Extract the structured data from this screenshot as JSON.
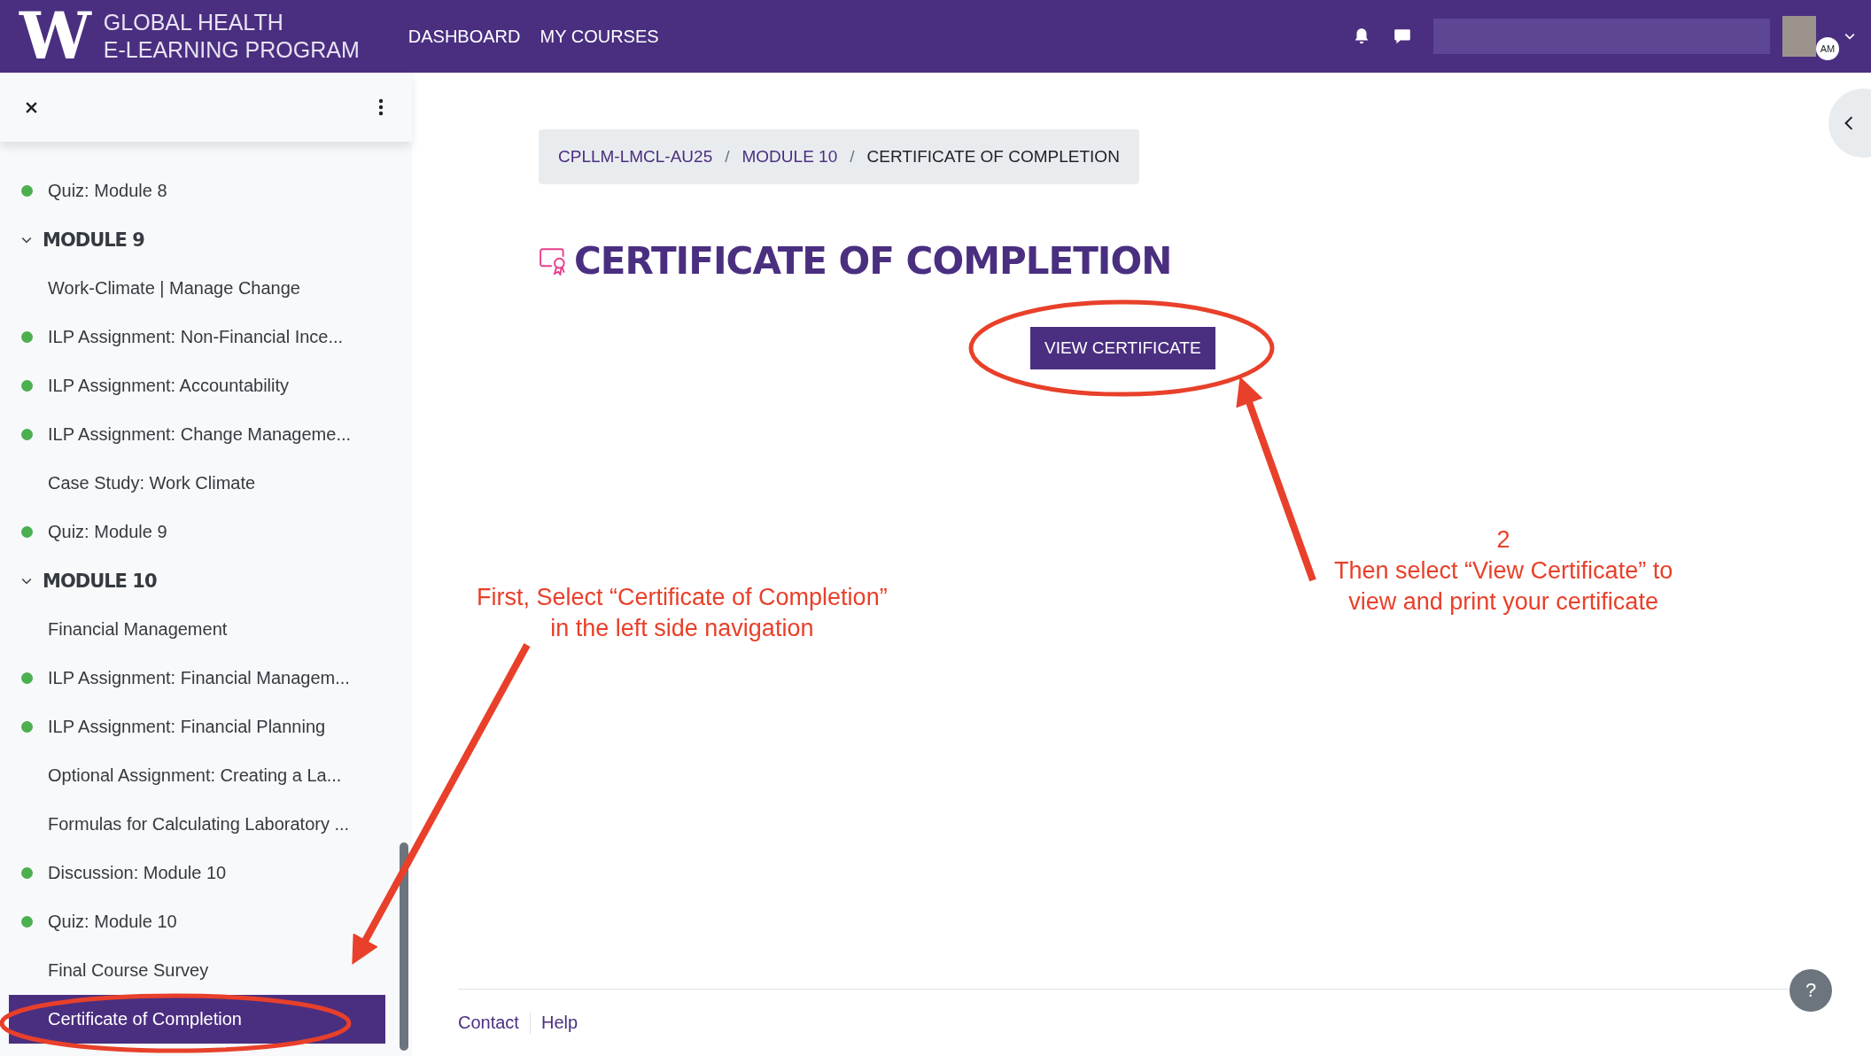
{
  "header": {
    "logo_letter": "W",
    "brand_lines": [
      "GLOBAL HEALTH",
      "E-LEARNING PROGRAM"
    ],
    "nav": [
      {
        "label": "DASHBOARD"
      },
      {
        "label": "MY COURSES"
      }
    ],
    "avatar_initials": "AM"
  },
  "sidebar": {
    "items": [
      {
        "kind": "activity",
        "label": "Quiz: Module 8",
        "completed": true,
        "selected": false
      },
      {
        "kind": "section",
        "label": "MODULE 9",
        "expanded": true,
        "children": [
          {
            "kind": "activity",
            "label": "Work-Climate | Manage Change",
            "completed": false,
            "selected": false
          },
          {
            "kind": "activity",
            "label": "ILP Assignment: Non-Financial Ince...",
            "completed": true,
            "selected": false
          },
          {
            "kind": "activity",
            "label": "ILP Assignment: Accountability",
            "completed": true,
            "selected": false
          },
          {
            "kind": "activity",
            "label": "ILP Assignment: Change Manageme...",
            "completed": true,
            "selected": false
          },
          {
            "kind": "activity",
            "label": "Case Study: Work Climate",
            "completed": false,
            "selected": false
          },
          {
            "kind": "activity",
            "label": "Quiz: Module 9",
            "completed": true,
            "selected": false
          }
        ]
      },
      {
        "kind": "section",
        "label": "MODULE 10",
        "expanded": true,
        "children": [
          {
            "kind": "activity",
            "label": "Financial Management",
            "completed": false,
            "selected": false
          },
          {
            "kind": "activity",
            "label": "ILP Assignment: Financial Managem...",
            "completed": true,
            "selected": false
          },
          {
            "kind": "activity",
            "label": "ILP Assignment: Financial Planning",
            "completed": true,
            "selected": false
          },
          {
            "kind": "activity",
            "label": "Optional Assignment: Creating a La...",
            "completed": false,
            "selected": false
          },
          {
            "kind": "activity",
            "label": "Formulas for Calculating Laboratory ...",
            "completed": false,
            "selected": false
          },
          {
            "kind": "activity",
            "label": "Discussion: Module 10",
            "completed": true,
            "selected": false
          },
          {
            "kind": "activity",
            "label": "Quiz: Module 10",
            "completed": true,
            "selected": false
          },
          {
            "kind": "activity",
            "label": "Final Course Survey",
            "completed": false,
            "selected": false
          },
          {
            "kind": "activity",
            "label": "Certificate of Completion",
            "completed": false,
            "selected": true
          }
        ]
      }
    ]
  },
  "breadcrumb": [
    {
      "label": "CPLLM-LMCL-AU25",
      "current": false
    },
    {
      "separator": "/",
      "label": "MODULE 10",
      "current": false
    },
    {
      "separator": "/",
      "label": "CERTIFICATE OF COMPLETION",
      "current": true
    }
  ],
  "page_title": "CERTIFICATE OF COMPLETION",
  "view_button": "VIEW CERTIFICATE",
  "annotations": [
    {
      "lines": [
        "First, Select “Certificate of Completion”",
        "in the left side navigation"
      ]
    },
    {
      "lines": [
        "2",
        "Then select “View Certificate” to",
        "view and print your certificate"
      ]
    }
  ],
  "footer": {
    "links": [
      "Contact",
      "Help"
    ],
    "help_button": "?"
  }
}
